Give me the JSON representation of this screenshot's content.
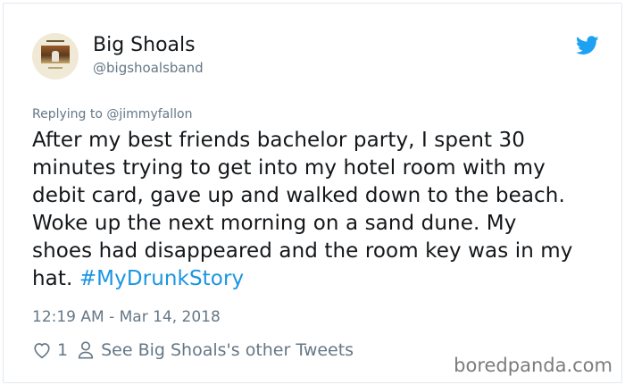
{
  "author": {
    "display_name": "Big Shoals",
    "handle": "@bigshoalsband"
  },
  "reply": {
    "prefix": "Replying to ",
    "mention": "@jimmyfallon"
  },
  "tweet": {
    "lines": [
      "After my best friends bachelor party, I spent 30",
      "minutes trying to get into my hotel room with my",
      "debit card, gave up and walked down to the beach.",
      "Woke up the next morning on a sand dune. My",
      "shoes had disappeared and the room key was in my"
    ],
    "last_line_text": "hat. ",
    "hashtag": "#MyDrunkStory",
    "timestamp": "12:19 AM - Mar 14, 2018"
  },
  "actions": {
    "like_count": "1",
    "profile_link": "See Big Shoals's other Tweets"
  },
  "watermark": "boredpanda.com",
  "icons": {
    "brand": "twitter-bird-icon",
    "like": "heart-icon",
    "profile": "person-icon"
  },
  "colors": {
    "twitter_blue": "#1da1f2",
    "hashtag": "#1b95e0",
    "secondary_text": "#657786",
    "primary_text": "#14171a"
  }
}
